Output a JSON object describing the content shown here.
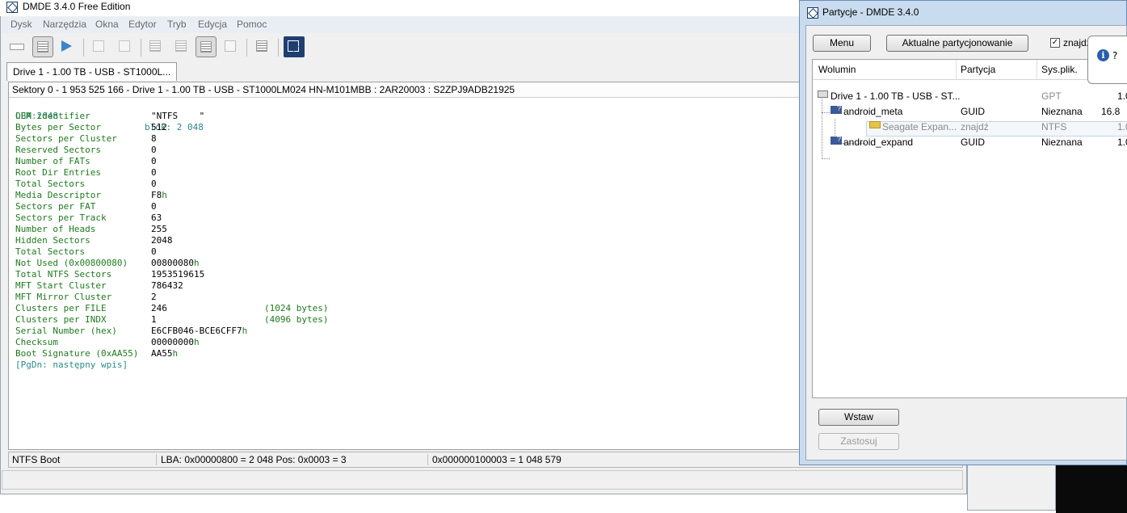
{
  "main_window": {
    "title": "DMDE 3.4.0 Free Edition",
    "menu": [
      "Dysk",
      "Narzędzia",
      "Okna",
      "Edytor",
      "Tryb",
      "Edycja",
      "Pomoc"
    ],
    "tab": "Drive 1 - 1.00 TB - USB - ST1000L...",
    "sector_header": "Sektory 0 - 1 953 525 166 - Drive 1 - 1.00 TB - USB - ST1000LM024 HN-M101MBB : 2AR20003 : S2ZPJ9ADB21925",
    "fields_head": {
      "label": "LBA:2048",
      "value": "blok: 2 048"
    },
    "fields": [
      {
        "label": "OEM identifier",
        "value": "\"NTFS    \"",
        "suffix": "",
        "note": ""
      },
      {
        "label": "Bytes per Sector",
        "value": "512",
        "suffix": "",
        "note": ""
      },
      {
        "label": "Sectors per Cluster",
        "value": "8",
        "suffix": "",
        "note": ""
      },
      {
        "label": "Reserved Sectors",
        "value": "0",
        "suffix": "",
        "note": ""
      },
      {
        "label": "Number of FATs",
        "value": "0",
        "suffix": "",
        "note": ""
      },
      {
        "label": "Root Dir Entries",
        "value": "0",
        "suffix": "",
        "note": ""
      },
      {
        "label": "Total Sectors",
        "value": "0",
        "suffix": "",
        "note": ""
      },
      {
        "label": "Media Descriptor",
        "value": "F8",
        "suffix": "h",
        "note": ""
      },
      {
        "label": "Sectors per FAT",
        "value": "0",
        "suffix": "",
        "note": ""
      },
      {
        "label": "Sectors per Track",
        "value": "63",
        "suffix": "",
        "note": ""
      },
      {
        "label": "Number of Heads",
        "value": "255",
        "suffix": "",
        "note": ""
      },
      {
        "label": "Hidden Sectors",
        "value": "2048",
        "suffix": "",
        "note": ""
      },
      {
        "label": "Total Sectors",
        "value": "0",
        "suffix": "",
        "note": ""
      },
      {
        "label": "Not Used (0x00800080)",
        "value": "00800080",
        "suffix": "h",
        "note": ""
      },
      {
        "label": "Total NTFS Sectors",
        "value": "1953519615",
        "suffix": "",
        "note": ""
      },
      {
        "label": "MFT Start Cluster",
        "value": "786432",
        "suffix": "",
        "note": ""
      },
      {
        "label": "MFT Mirror Cluster",
        "value": "2",
        "suffix": "",
        "note": ""
      },
      {
        "label": "Clusters per FILE",
        "value": "246",
        "suffix": "",
        "note": "(1024 bytes)"
      },
      {
        "label": "Clusters per INDX",
        "value": "1",
        "suffix": "",
        "note": "(4096 bytes)"
      },
      {
        "label": "Serial Number (hex)",
        "value": "E6CFB046-BCE6CFF7",
        "suffix": "h",
        "note": ""
      },
      {
        "label": "Checksum",
        "value": "00000000",
        "suffix": "h",
        "note": ""
      },
      {
        "label": "Boot Signature (0xAA55)",
        "value": "AA55",
        "suffix": "h",
        "note": ""
      }
    ],
    "pgdn": "[PgDn: następny wpis]",
    "status": {
      "mode": "NTFS Boot",
      "lba": "LBA: 0x00000800 = 2 048  Pos: 0x0003 = 3",
      "offset": "0x000000100003 = 1 048 579"
    }
  },
  "partitions": {
    "title": "Partycje - DMDE 3.4.0",
    "menu_button": "Menu",
    "current_button": "Aktualne partycjonowanie",
    "checkbox_label": "znajdź",
    "checkbox_checked": "✓",
    "info_q": "?",
    "columns": [
      "Wolumin",
      "Partycja",
      "Sys.plik.",
      ""
    ],
    "rows": [
      {
        "name": "Drive 1 - 1.00 TB - USB - ST...",
        "part": "",
        "fs": "GPT",
        "size": "1.0"
      },
      {
        "name": "android_meta",
        "part": "GUID",
        "fs": "Nieznana",
        "size": "16.8"
      },
      {
        "name": "Seagate Expan...",
        "part": "znajdź",
        "fs": "NTFS",
        "size": "1.0"
      },
      {
        "name": "android_expand",
        "part": "GUID",
        "fs": "Nieznana",
        "size": "1.0"
      }
    ],
    "insert_button": "Wstaw",
    "apply_button": "Zastosuj"
  }
}
